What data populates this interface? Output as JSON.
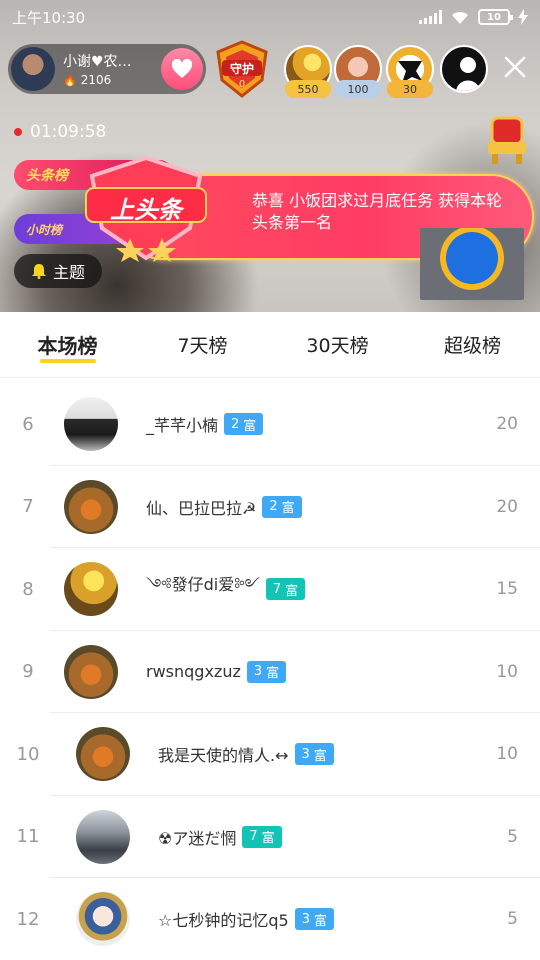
{
  "status_bar": {
    "time": "上午10:30",
    "battery": "10"
  },
  "host": {
    "name": "小谢♥农…",
    "fans": "2106"
  },
  "guard": {
    "label": "守护",
    "count": "0"
  },
  "viewers": [
    {
      "badge": "550",
      "badge_color": "#f5c242"
    },
    {
      "badge": "100",
      "badge_color": "#b9cfe8"
    },
    {
      "badge": "30",
      "badge_color": "#f3b63a"
    }
  ],
  "timer": "01:09:58",
  "rank_pills": {
    "headline": "头条榜",
    "hourly": "小时榜"
  },
  "banner": {
    "title": "上头条",
    "message": "恭喜 小饭团求过月底任务 获得本轮头条第一名"
  },
  "topic_button": "主题",
  "tabs": [
    "本场榜",
    "7天榜",
    "30天榜",
    "超级榜"
  ],
  "ranking": [
    {
      "rank": "6",
      "name": "_芊芊小楠",
      "level": "2",
      "level_tag": "富",
      "level_color": "blue",
      "score": "20"
    },
    {
      "rank": "7",
      "name": "仙、巴拉巴拉☭",
      "level": "2",
      "level_tag": "富",
      "level_color": "blue",
      "score": "20"
    },
    {
      "rank": "8",
      "name": "༺發仔di爱༻",
      "level": "7",
      "level_tag": "富",
      "level_color": "teal",
      "score": "15"
    },
    {
      "rank": "9",
      "name": "rwsnqgxzuz",
      "level": "3",
      "level_tag": "富",
      "level_color": "blue",
      "score": "10"
    },
    {
      "rank": "10",
      "name": "我是天使的情人.↔",
      "level": "3",
      "level_tag": "富",
      "level_color": "blue",
      "score": "10"
    },
    {
      "rank": "11",
      "name": "☢ア迷だ惘",
      "level": "7",
      "level_tag": "富",
      "level_color": "teal",
      "score": "5"
    },
    {
      "rank": "12",
      "name": "☆七秒钟的记忆q5",
      "level": "3",
      "level_tag": "富",
      "level_color": "blue",
      "score": "5"
    }
  ]
}
